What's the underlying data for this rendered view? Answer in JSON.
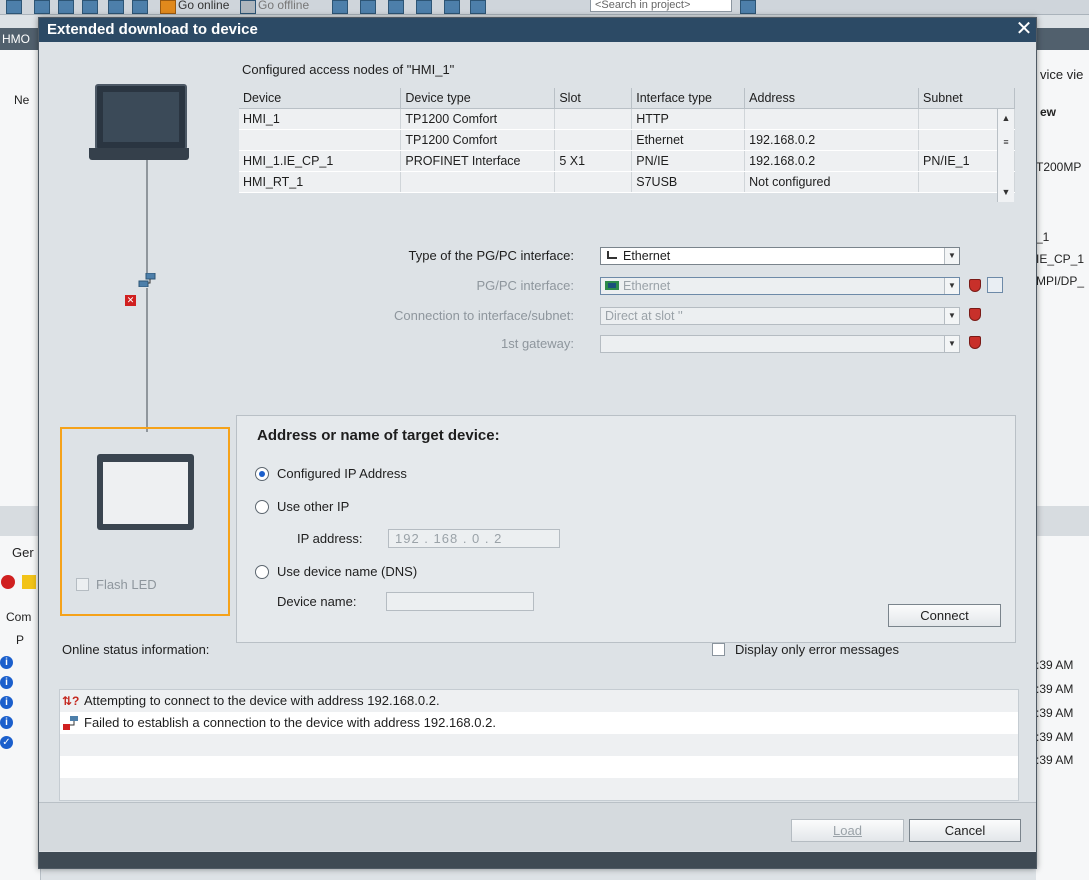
{
  "app": {
    "toolbar": {
      "go_online": "Go online",
      "go_offline": "Go offline",
      "search_placeholder": "<Search in project>"
    },
    "left_title": "HMO",
    "left_partial": {
      "tree_item": "Ne",
      "tab": "Ger",
      "col": "Com",
      "col2": "P"
    },
    "right_partial": {
      "tab": "vice vie",
      "view": "ew",
      "items": [
        "T200MP",
        "_1",
        "IE_CP_1",
        "MPI/DP_"
      ],
      "times": [
        ":39 AM",
        ":39 AM",
        ":39 AM",
        ":39 AM",
        ":39 AM"
      ]
    }
  },
  "dialog": {
    "title": "Extended download to device",
    "close_symbol": "✕",
    "table": {
      "caption": "Configured access nodes of \"HMI_1\"",
      "columns": [
        "Device",
        "Device type",
        "Slot",
        "Interface type",
        "Address",
        "Subnet"
      ],
      "rows": [
        [
          "HMI_1",
          "TP1200 Comfort",
          "",
          "HTTP",
          "",
          ""
        ],
        [
          "",
          "TP1200 Comfort",
          "",
          "Ethernet",
          "192.168.0.2",
          ""
        ],
        [
          "HMI_1.IE_CP_1",
          "PROFINET Interface",
          "5 X1",
          "PN/IE",
          "192.168.0.2",
          "PN/IE_1"
        ],
        [
          "HMI_RT_1",
          "",
          "",
          "S7USB",
          "Not configured",
          ""
        ]
      ]
    },
    "form": {
      "pgpc_type_label": "Type of the PG/PC interface:",
      "pgpc_type_value": "Ethernet",
      "pgpc_label": "PG/PC interface:",
      "pgpc_value": "Ethernet",
      "conn_label": "Connection to interface/subnet:",
      "conn_value": "Direct at slot ''",
      "gateway_label": "1st gateway:",
      "gateway_value": ""
    },
    "device": {
      "flash_led": "Flash LED"
    },
    "address": {
      "heading": "Address or name of target device:",
      "opt_configured": "Configured IP Address",
      "opt_other": "Use other IP",
      "ip_label": "IP address:",
      "ip_value": "192 . 168 . 0   . 2",
      "opt_dns": "Use device name (DNS)",
      "name_label": "Device name:",
      "connect": "Connect"
    },
    "status": {
      "label": "Online status information:",
      "only_errors": "Display only error messages",
      "messages": [
        "Attempting to connect to the device with address 192.168.0.2.",
        "Failed to establish a connection to the device with address 192.168.0.2."
      ]
    },
    "footer": {
      "load": "Load",
      "cancel": "Cancel"
    }
  },
  "colors": {
    "title_bar": "#2c4a65",
    "highlight": "#f5a21a",
    "error": "#d02020",
    "accent": "#1b5fcc"
  }
}
